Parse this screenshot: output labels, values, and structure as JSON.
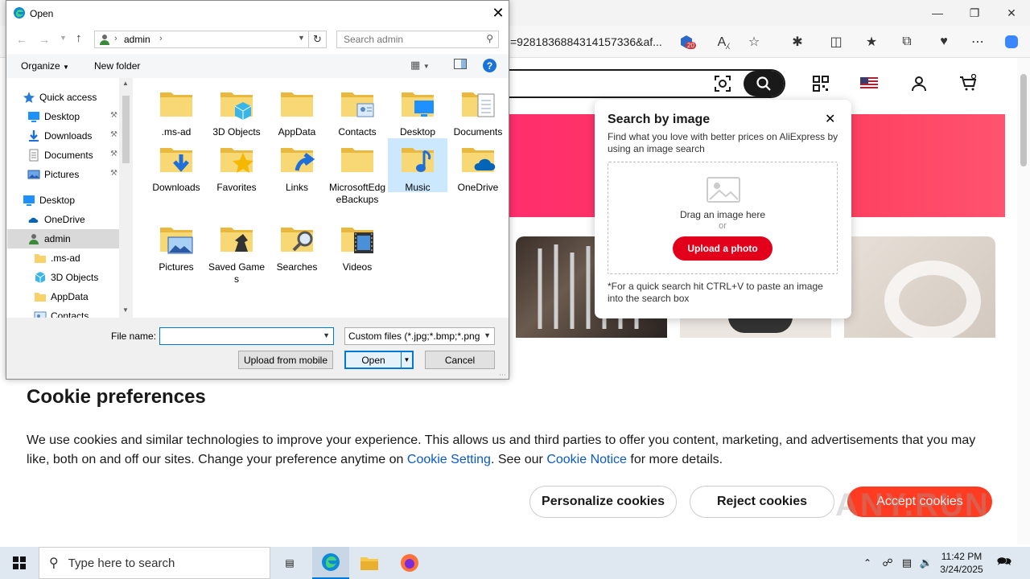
{
  "dialog": {
    "title": "Open",
    "address": {
      "path_segment": "admin"
    },
    "search_placeholder": "Search admin",
    "commands": {
      "organize": "Organize",
      "new_folder": "New folder"
    },
    "nav_items": [
      {
        "label": "Quick access",
        "icon": "star-icon",
        "pinned": false
      },
      {
        "label": "Desktop",
        "icon": "desktop-icon",
        "pinned": true
      },
      {
        "label": "Downloads",
        "icon": "download-icon",
        "pinned": true
      },
      {
        "label": "Documents",
        "icon": "documents-icon",
        "pinned": true
      },
      {
        "label": "Pictures",
        "icon": "pictures-icon",
        "pinned": true
      },
      {
        "label": "Desktop",
        "icon": "desktop-icon",
        "pinned": false
      },
      {
        "label": "OneDrive",
        "icon": "onedrive-icon",
        "pinned": false
      },
      {
        "label": "admin",
        "icon": "user-icon",
        "pinned": false
      },
      {
        "label": ".ms-ad",
        "icon": "folder-icon",
        "pinned": false
      },
      {
        "label": "3D Objects",
        "icon": "3d-objects-icon",
        "pinned": false
      },
      {
        "label": "AppData",
        "icon": "folder-icon",
        "pinned": false
      },
      {
        "label": "Contacts",
        "icon": "contacts-icon",
        "pinned": false
      }
    ],
    "files": [
      {
        "label": ".ms-ad",
        "icon": "folder-icon"
      },
      {
        "label": "3D Objects",
        "icon": "3d-objects-icon"
      },
      {
        "label": "AppData",
        "icon": "folder-icon"
      },
      {
        "label": "Contacts",
        "icon": "contacts-icon"
      },
      {
        "label": "Desktop",
        "icon": "desktop-icon"
      },
      {
        "label": "Documents",
        "icon": "documents-icon"
      },
      {
        "label": "Downloads",
        "icon": "download-icon"
      },
      {
        "label": "Favorites",
        "icon": "star-icon"
      },
      {
        "label": "Links",
        "icon": "link-icon"
      },
      {
        "label": "MicrosoftEdgeBackups",
        "icon": "folder-icon"
      },
      {
        "label": "Music",
        "icon": "music-icon"
      },
      {
        "label": "OneDrive",
        "icon": "onedrive-icon"
      },
      {
        "label": "Pictures",
        "icon": "pictures-icon"
      },
      {
        "label": "Saved Games",
        "icon": "games-icon"
      },
      {
        "label": "Searches",
        "icon": "search-icon"
      },
      {
        "label": "Videos",
        "icon": "videos-icon"
      }
    ],
    "selected_file": "Music",
    "file_name_label": "File name:",
    "file_name_value": "",
    "file_type": "Custom files (*.jpg;*.bmp;*.png",
    "buttons": {
      "upload_mobile": "Upload from mobile",
      "open": "Open",
      "cancel": "Cancel"
    }
  },
  "browser": {
    "url_fragment": "=9281836884314157336&af...",
    "extension_badge": "20"
  },
  "popup": {
    "title": "Search by image",
    "description": "Find what you love with better prices on AliExpress by using an image search",
    "drag_text": "Drag an image here",
    "or_text": "or",
    "upload_button": "Upload a photo",
    "note": "*For a quick search hit CTRL+V to paste an image into the search box"
  },
  "cookie": {
    "title": "Cookie preferences",
    "text_before": "We use cookies and similar technologies to improve your experience. This allows us and third parties to offer you content, marketing, and advertisements that you may like, both on and off our sites. Change your preference anytime on ",
    "setting_link": "Cookie Setting",
    "text_middle": ". See our ",
    "notice_link": "Cookie Notice",
    "text_after": " for more details.",
    "personalize": "Personalize cookies",
    "reject": "Reject cookies",
    "accept": "Accept cookies"
  },
  "watermark": "ANY.RUN",
  "taskbar": {
    "search_placeholder": "Type here to search",
    "time": "11:42 PM",
    "date": "3/24/2025"
  },
  "colors": {
    "accent": "#0078d7",
    "folder": "#f7d26a",
    "aliexpress_red": "#e3001b",
    "accept_orange": "#ff3b21",
    "selection": "#cce8ff"
  }
}
